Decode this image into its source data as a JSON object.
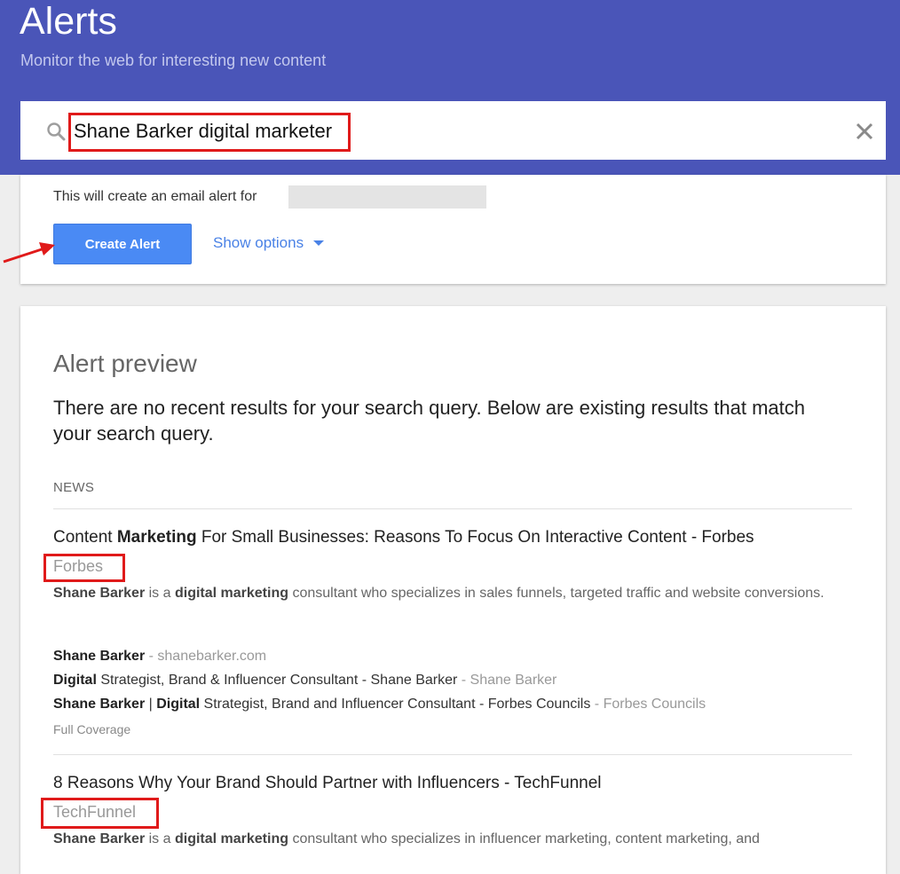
{
  "header": {
    "title": "Alerts",
    "subtitle": "Monitor the web for interesting new content"
  },
  "search": {
    "value": "Shane Barker digital marketer",
    "search_icon": "search-icon",
    "clear_icon": "close-icon"
  },
  "create": {
    "email_prefix": "This will create an email alert for",
    "button_label": "Create Alert",
    "options_label": "Show options"
  },
  "preview": {
    "title": "Alert preview",
    "message": "There are no recent results for your search query. Below are existing results that match your search query.",
    "section_label": "NEWS",
    "results": [
      {
        "title_a": "Content ",
        "title_b": "Marketing",
        "title_c": " For Small Businesses: Reasons To Focus On Interactive Content - Forbes",
        "source": "Forbes",
        "snippet_1": "Shane Barker",
        "snippet_2": " is a ",
        "snippet_3": "digital marketing",
        "snippet_4": " consultant who specializes in sales funnels, targeted traffic and website conversions.",
        "related": [
          {
            "b1": "Shane Barker",
            "t1": "",
            "b2": "",
            "t2": "",
            "src": " - shanebarker.com"
          },
          {
            "b1": "Digital",
            "t1": " Strategist, Brand & Influencer Consultant - Shane Barker",
            "b2": "",
            "t2": "",
            "src": " - Shane Barker"
          },
          {
            "b1": "Shane Barker",
            "t1": " | ",
            "b2": "Digital",
            "t2": " Strategist, Brand and Influencer Consultant - Forbes Councils",
            "src": " - Forbes Councils"
          }
        ],
        "coverage": "Full Coverage"
      },
      {
        "title_a": "8 Reasons Why Your Brand Should Partner with Influencers - TechFunnel",
        "source": "TechFunnel",
        "snippet_1": "Shane Barker",
        "snippet_2": " is a ",
        "snippet_3": "digital marketing",
        "snippet_4": " consultant who specializes in influencer marketing, content marketing, and"
      }
    ]
  },
  "colors": {
    "header_bg": "#4a55b8",
    "button_bg": "#4a8af4",
    "link": "#4a82e6",
    "highlight_box": "#e01a1a"
  }
}
